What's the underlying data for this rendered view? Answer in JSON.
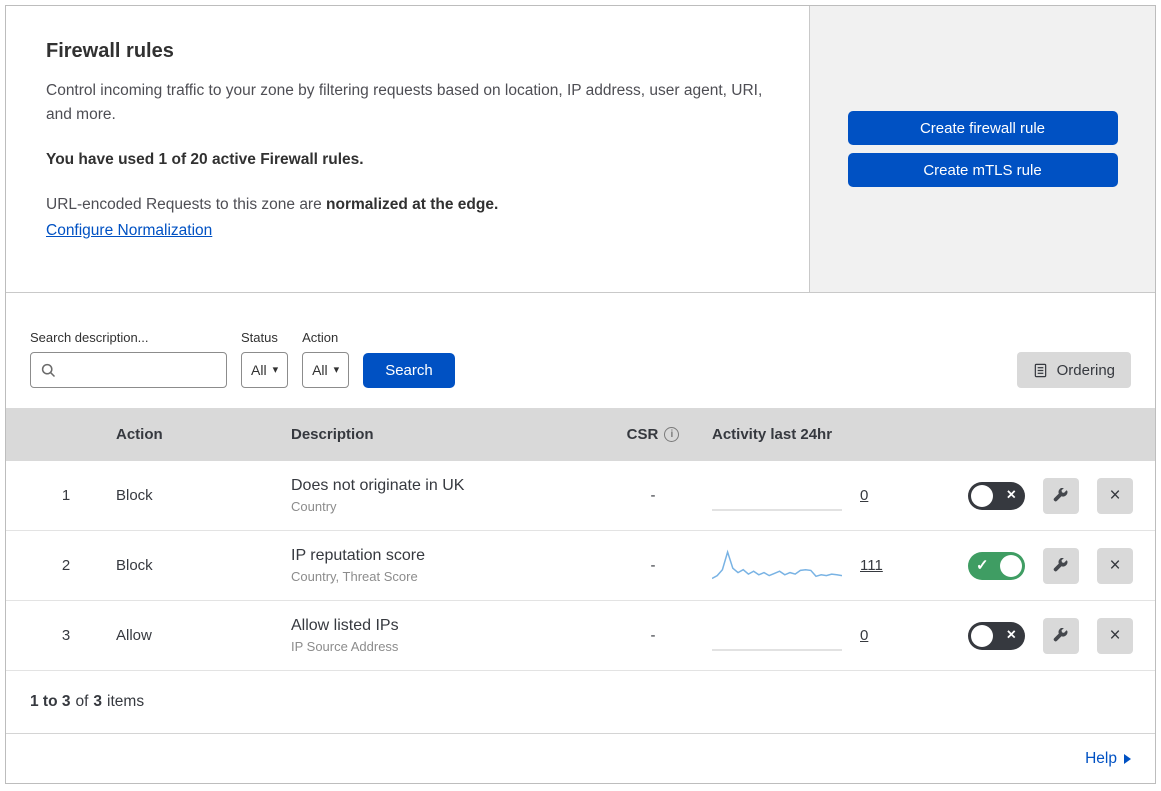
{
  "theme": {
    "accent_blue": "#0051c3",
    "toggle_on_green": "#3f9d63",
    "toggle_off_dark": "#36393f",
    "spark_blue": "#79b3e4",
    "spark_flat": "#d9d9d9"
  },
  "icons": {
    "close": "×",
    "check": "✓",
    "caret_down": "▾",
    "info": "i"
  },
  "header": {
    "title": "Firewall rules",
    "description": "Control incoming traffic to your zone by filtering requests based on location, IP address, user agent, URI, and more.",
    "usage": "You have used 1 of 20 active Firewall rules.",
    "normalization": {
      "prefix": "URL-encoded Requests to this zone are ",
      "bold": "normalized at the edge.",
      "link": "Configure Normalization"
    },
    "actions": {
      "create_firewall_rule": "Create firewall rule",
      "create_mtls_rule": "Create mTLS rule"
    }
  },
  "filters": {
    "search_label": "Search description...",
    "status": {
      "label": "Status",
      "value": "All"
    },
    "action": {
      "label": "Action",
      "value": "All"
    },
    "search_button": "Search",
    "ordering_button": "Ordering"
  },
  "table": {
    "headers": {
      "action": "Action",
      "description": "Description",
      "csr": "CSR",
      "activity": "Activity last 24hr"
    },
    "rows": [
      {
        "priority": "1",
        "action": "Block",
        "description": "Does not originate in UK",
        "criteria": "Country",
        "csr": "-",
        "count": "0",
        "enabled": false,
        "sparkline": [
          0,
          0,
          0,
          0,
          0,
          0,
          0,
          0,
          0,
          0,
          0,
          0,
          0,
          0,
          0,
          0,
          0,
          0,
          0,
          0,
          0,
          0,
          0,
          0
        ]
      },
      {
        "priority": "2",
        "action": "Block",
        "description": "IP reputation score",
        "criteria": "Country, Threat Score",
        "csr": "-",
        "count": "111",
        "enabled": true,
        "sparkline": [
          2,
          6,
          14,
          38,
          16,
          10,
          14,
          8,
          12,
          7,
          10,
          6,
          9,
          12,
          7,
          10,
          8,
          13,
          14,
          13,
          5,
          7,
          6,
          8,
          7,
          6
        ]
      },
      {
        "priority": "3",
        "action": "Allow",
        "description": "Allow listed IPs",
        "criteria": "IP Source Address",
        "csr": "-",
        "count": "0",
        "enabled": false,
        "sparkline": [
          0,
          0,
          0,
          0,
          0,
          0,
          0,
          0,
          0,
          0,
          0,
          0,
          0,
          0,
          0,
          0,
          0,
          0,
          0,
          0,
          0,
          0,
          0,
          0
        ]
      }
    ],
    "summary": {
      "range": "1 to 3",
      "of": "of",
      "total": "3",
      "items": "items"
    }
  },
  "footer": {
    "help": "Help"
  }
}
